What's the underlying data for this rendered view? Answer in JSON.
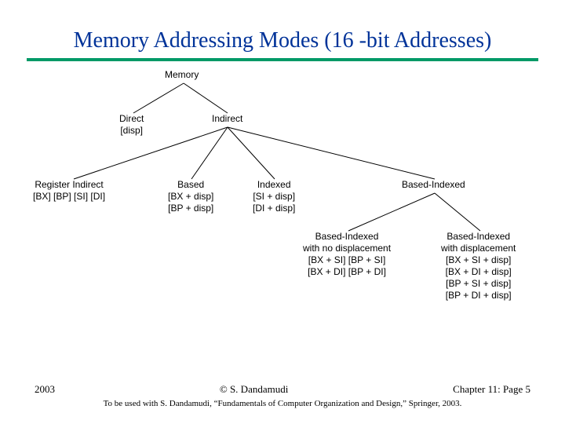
{
  "title": "Memory Addressing Modes (16 -bit Addresses)",
  "nodes": {
    "root": "Memory",
    "direct": "Direct\n[disp]",
    "indirect": "Indirect",
    "regind": "Register Indirect\n[BX]  [BP]  [SI]  [DI]",
    "based": "Based\n[BX + disp]\n[BP + disp]",
    "indexed": "Indexed\n[SI + disp]\n[DI + disp]",
    "bindexed": "Based-Indexed",
    "bi_nodisp": "Based-Indexed\nwith no displacement\n[BX + SI]  [BP + SI]\n[BX + DI]  [BP + DI]",
    "bi_disp": "Based-Indexed\nwith displacement\n[BX + SI + disp]\n[BX + DI + disp]\n[BP + SI + disp]\n[BP + DI + disp]"
  },
  "footer": {
    "year": "2003",
    "center": "© S. Dandamudi",
    "right": "Chapter 11: Page 5",
    "sub": "To be used with S. Dandamudi, “Fundamentals of Computer Organization and Design,” Springer, 2003."
  }
}
